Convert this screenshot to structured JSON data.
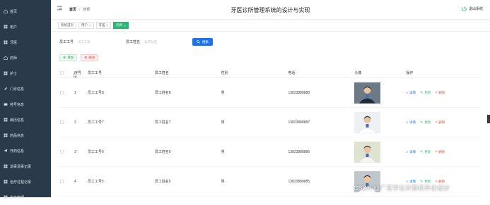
{
  "sidebar": {
    "items": [
      {
        "label": "首页",
        "icon": "home-icon"
      },
      {
        "label": "用户",
        "icon": "grid-icon"
      },
      {
        "label": "牙医",
        "icon": "grid-icon"
      },
      {
        "label": "药师",
        "icon": "home-icon"
      },
      {
        "label": "护士",
        "icon": "grid-icon"
      },
      {
        "label": "门诊信息",
        "icon": "pen-icon"
      },
      {
        "label": "挂号信息",
        "icon": "card-icon"
      },
      {
        "label": "病历信息",
        "icon": "grid-icon"
      },
      {
        "label": "药品信息",
        "icon": "grid-icon"
      },
      {
        "label": "开药信息",
        "icon": "send-icon"
      },
      {
        "label": "消毒清毒记录",
        "icon": "grid-icon"
      },
      {
        "label": "治疗过程记录",
        "icon": "grid-icon"
      },
      {
        "label": "库存管理",
        "icon": "grid-icon"
      }
    ]
  },
  "header": {
    "breadcrumb_home": "首页",
    "breadcrumb_current": "药师",
    "title": "牙医诊所管理系统的设计与实现",
    "logout": "退出系统"
  },
  "tabs": [
    {
      "label": "系统首页",
      "closable": false,
      "active": false
    },
    {
      "label": "用户",
      "closable": true,
      "active": false
    },
    {
      "label": "牙医",
      "closable": true,
      "active": false
    },
    {
      "label": "药师",
      "closable": true,
      "active": true
    }
  ],
  "search": {
    "field1_label": "员工工号",
    "field1_placeholder": "员工工号",
    "field2_label": "员工姓名",
    "field2_placeholder": "员工姓名",
    "button": "搜索"
  },
  "actions": {
    "add": "增加",
    "delete": "删除"
  },
  "table": {
    "columns": [
      "序号",
      "员工工号",
      "员工姓名",
      "性别",
      "电话",
      "头像",
      "操作"
    ],
    "ops": {
      "view": "详情",
      "edit": "更新",
      "delete": "删除"
    },
    "rows": [
      {
        "idx": "1",
        "no": "员工工号8",
        "name": "员工姓名8",
        "sex": "男",
        "tel": "13823888888"
      },
      {
        "idx": "2",
        "no": "员工工号7",
        "name": "员工姓名7",
        "sex": "男",
        "tel": "13823888887"
      },
      {
        "idx": "3",
        "no": "员工工号6",
        "name": "员工姓名6",
        "sex": "男",
        "tel": "13823888886"
      },
      {
        "idx": "4",
        "no": "员工工号5",
        "name": "员工姓名5",
        "sex": "男",
        "tel": "13823888885"
      }
    ]
  },
  "watermark": "CSDN @广花学长计算机毕业设计",
  "colors": {
    "sidebar": "#2b3a4a",
    "active_tab": "#2bb673",
    "primary": "#1a73e8",
    "danger": "#d9534f"
  }
}
